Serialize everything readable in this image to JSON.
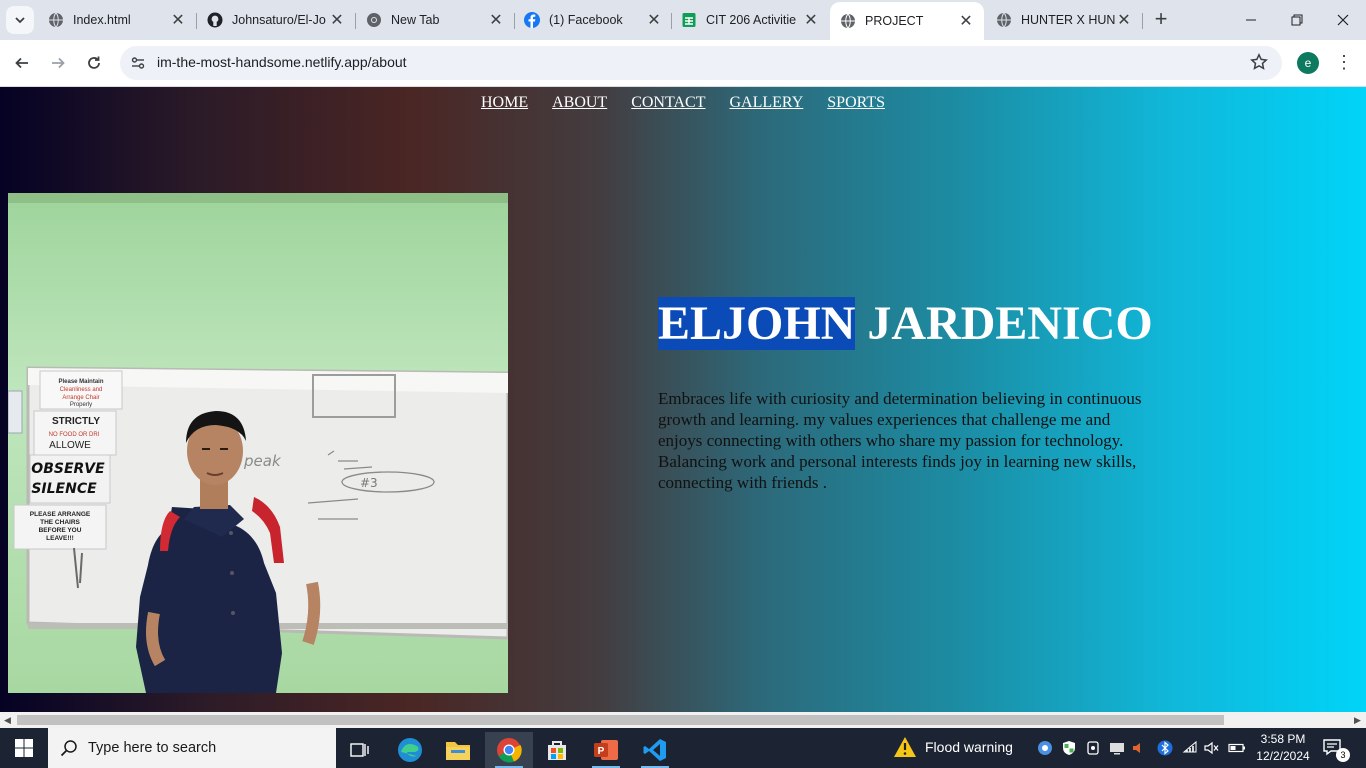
{
  "browser": {
    "tabs": [
      {
        "title": "Index.html",
        "icon": "globe-icon",
        "active": false
      },
      {
        "title": "Johnsaturo/El-Jo",
        "icon": "github-icon",
        "active": false
      },
      {
        "title": "New Tab",
        "icon": "chrome-icon",
        "active": false
      },
      {
        "title": "(1) Facebook",
        "icon": "facebook-icon",
        "active": false
      },
      {
        "title": "CIT 206 Activitie",
        "icon": "sheets-icon",
        "active": false
      },
      {
        "title": "PROJECT",
        "icon": "globe-icon",
        "active": true
      },
      {
        "title": "HUNTER X HUN",
        "icon": "globe-icon",
        "active": false
      }
    ],
    "url": "im-the-most-handsome.netlify.app/about",
    "profile_initial": "e",
    "profile_color": "#0d7a5f"
  },
  "page": {
    "nav": [
      "HOME",
      "ABOUT",
      "CONTACT",
      "GALLERY",
      "SPORTS"
    ],
    "heading_first": "ELJOHN",
    "heading_last": "JARDENICO",
    "bio": "Embraces life with curiosity and determination believing in continuous growth and learning. my values experiences that challenge me and enjoys connecting with others who share my passion for technology. Balancing work and personal interests finds joy in learning new skills, connecting with friends .",
    "photo": {
      "signs": [
        "Please Maintain Cleanliness and Arrange Chair Properly",
        "STRICTLY",
        "NO FOOD OR DRI",
        "ALLOWE",
        "OBSERVE",
        "SILENCE",
        "PLEASE ARRANGE THE CHAIRS BEFORE YOU LEAVE!!!"
      ],
      "board_text": [
        "peak",
        "#3"
      ]
    }
  },
  "taskbar": {
    "search_placeholder": "Type here to search",
    "weather_alert": "Flood warning",
    "time": "3:58 PM",
    "date": "12/2/2024",
    "notification_count": "3"
  }
}
